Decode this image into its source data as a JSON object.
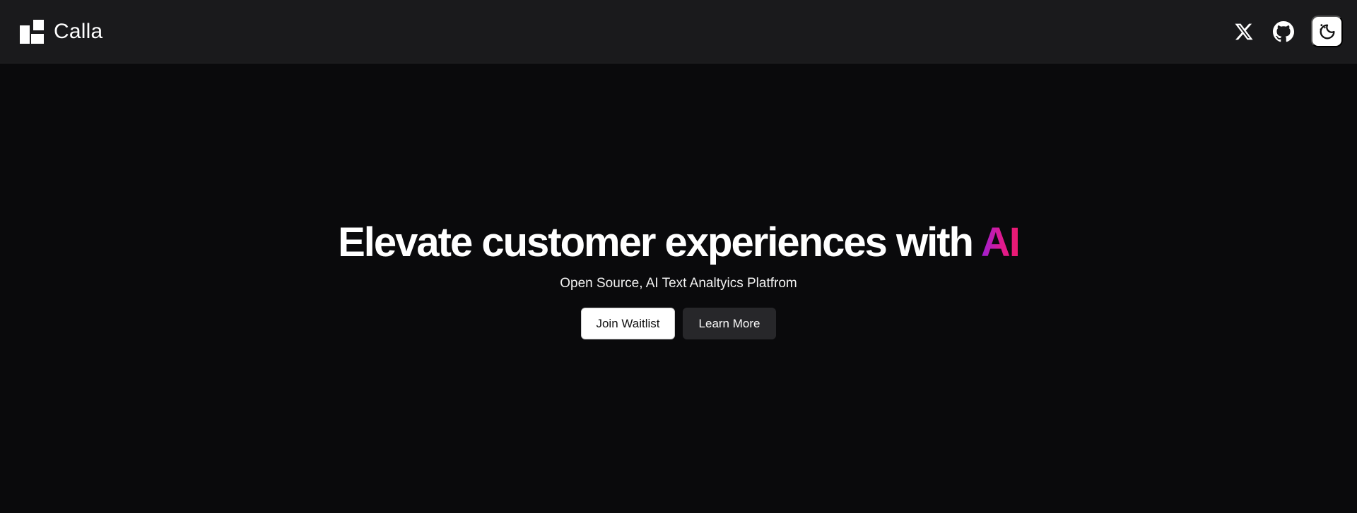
{
  "header": {
    "brand_name": "Calla",
    "icons": {
      "logo": "calla-logo-icon",
      "x": "x-twitter-icon",
      "github": "github-icon",
      "theme": "theme-toggle-moon-icon"
    }
  },
  "hero": {
    "headline_main": "Elevate customer experiences with ",
    "headline_accent": "AI",
    "subtitle": "Open Source, AI Text Analtyics Platfrom",
    "primary_button": "Join Waitlist",
    "secondary_button": "Learn More"
  },
  "colors": {
    "background": "#0a0a0c",
    "header_background": "#1a1a1c",
    "accent_gradient_start": "#9b1fd6",
    "accent_gradient_end": "#ec1a6d"
  }
}
